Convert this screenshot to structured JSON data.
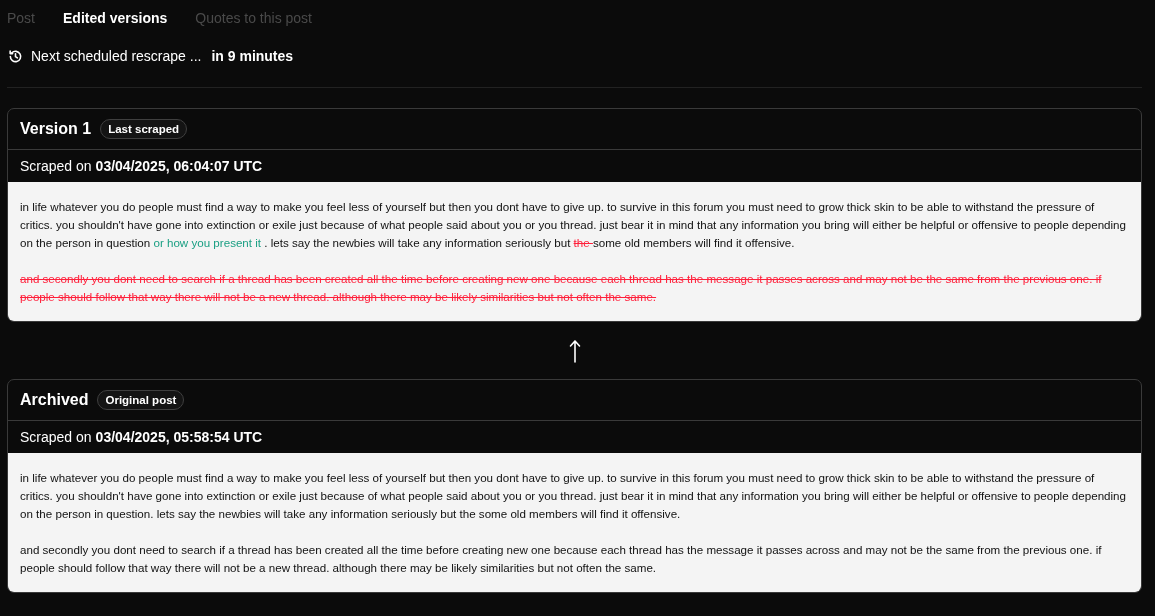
{
  "tabs": [
    {
      "label": "Post",
      "selected": false
    },
    {
      "label": "Edited versions",
      "selected": true
    },
    {
      "label": "Quotes to this post",
      "selected": false
    }
  ],
  "rescrape": {
    "label": "Next scheduled rescrape ...",
    "value": "in 9 minutes"
  },
  "versions": [
    {
      "title": "Version 1",
      "badge": "Last scraped",
      "scraped_label": "Scraped on",
      "scraped_time": "03/04/2025, 06:04:07 UTC",
      "paragraphs": [
        {
          "segments": [
            {
              "kind": "plain",
              "text": "in life whatever you do people must find a way to make you feel less of yourself but then you dont have to give up. to survive in this forum you must need to grow thick skin to be able to withstand the pressure of critics. you shouldn't have gone into extinction or exile just because of what people said about you or you thread. just bear it in mind that any information you bring will either be helpful or offensive to people depending on the person in question "
            },
            {
              "kind": "added",
              "text": "or how you present it"
            },
            {
              "kind": "plain",
              "text": " . lets say the newbies will take any information seriously but "
            },
            {
              "kind": "removed",
              "text": "the "
            },
            {
              "kind": "plain",
              "text": "some old members will find it offensive."
            }
          ]
        },
        {
          "segments": [
            {
              "kind": "removed",
              "text": "and secondly you dont need to search if a thread has been created all the time before creating new one because each thread has the message it passes across and may not be the same from the previous one. if people should follow that way there will not be a new thread. although there may be likely similarities but not often the same."
            }
          ]
        }
      ]
    },
    {
      "title": "Archived",
      "badge": "Original post",
      "scraped_label": "Scraped on",
      "scraped_time": "03/04/2025, 05:58:54 UTC",
      "paragraphs": [
        {
          "segments": [
            {
              "kind": "plain",
              "text": "in life whatever you do people must find a way to make you feel less of yourself but then you dont have to give up. to survive in this forum you must need to grow thick skin to be able to withstand the pressure of critics. you shouldn't have gone into extinction or exile just because of what people said about you or you thread. just bear it in mind that any information you bring will either be helpful or offensive to people depending on the person in question. lets say the newbies will take any information seriously but the some old members will find it offensive."
            }
          ]
        },
        {
          "segments": [
            {
              "kind": "plain",
              "text": "and secondly you dont need to search if a thread has been created all the time before creating new one because each thread has the message it passes across and may not be the same from the previous one. if people should follow that way there will not be a new thread. although there may be likely similarities but not often the same."
            }
          ]
        }
      ]
    }
  ]
}
